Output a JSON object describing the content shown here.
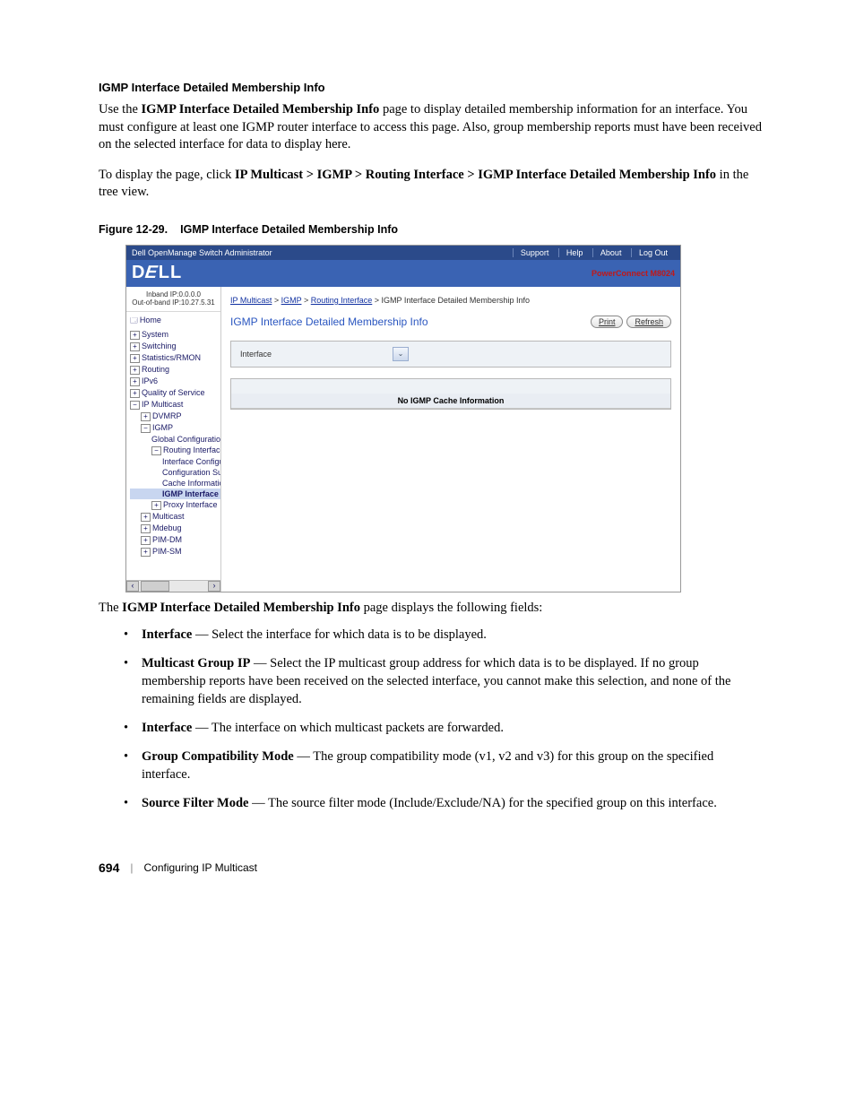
{
  "heading": "IGMP Interface Detailed Membership Info",
  "para1_a": "Use the ",
  "para1_bold": "IGMP Interface Detailed Membership Info",
  "para1_b": " page to display detailed membership information for an interface. You must configure at least one IGMP router interface to access this page. Also, group membership reports must have been received on the selected interface for data to display here.",
  "para2_a": "To display the page, click ",
  "para2_bold": "IP Multicast > IGMP > Routing Interface > IGMP Interface Detailed Membership Info",
  "para2_b": " in the tree view.",
  "fig_num": "Figure 12-29.",
  "fig_title": "IGMP Interface Detailed Membership Info",
  "screenshot": {
    "topbar_left": "Dell OpenManage Switch Administrator",
    "topbar_links": [
      "Support",
      "Help",
      "About",
      "Log Out"
    ],
    "brand": "DELL",
    "model": "PowerConnect M8024",
    "nav_ip1": "Inband IP:0.0.0.0",
    "nav_ip2": "Out-of-band IP:10.27.5.31",
    "nav": {
      "home": "Home",
      "system": "System",
      "switching": "Switching",
      "stats": "Statistics/RMON",
      "routing": "Routing",
      "ipv6": "IPv6",
      "qos": "Quality of Service",
      "ipmc": "IP Multicast",
      "dvmrp": "DVMRP",
      "igmp": "IGMP",
      "global": "Global Configuration",
      "rif": "Routing Interface",
      "ifconf": "Interface Configura",
      "confsum": "Configuration Sum",
      "cache": "Cache Information",
      "selected": "IGMP Interface D",
      "proxy": "Proxy Interface",
      "multicast": "Multicast",
      "mdebug": "Mdebug",
      "pimdm": "PIM-DM",
      "pimsm": "PIM-SM"
    },
    "breadcrumb": {
      "a": "IP Multicast",
      "b": "IGMP",
      "c": "Routing Interface",
      "d": "IGMP Interface Detailed Membership Info"
    },
    "main_title": "IGMP Interface Detailed Membership Info",
    "btn_print": "Print",
    "btn_refresh": "Refresh",
    "field_label": "Interface",
    "panel2_hdr": "No IGMP Cache Information"
  },
  "after_a": "The ",
  "after_bold": "IGMP Interface Detailed Membership Info",
  "after_b": " page displays the following fields:",
  "bullets": [
    {
      "term": "Interface",
      "desc": " — Select the interface for which data is to be displayed."
    },
    {
      "term": "Multicast Group IP",
      "desc": " — Select the IP multicast group address for which data is to be displayed. If no group membership reports have been received on the selected interface, you cannot make this selection, and none of the remaining fields are displayed."
    },
    {
      "term": "Interface",
      "desc": " — The interface on which multicast packets are forwarded."
    },
    {
      "term": "Group Compatibility Mode",
      "desc": " — The group compatibility mode (v1, v2 and v3) for this group on the specified interface."
    },
    {
      "term": "Source Filter Mode",
      "desc": " — The source filter mode (Include/Exclude/NA) for the specified group on this interface."
    }
  ],
  "footer_page": "694",
  "footer_chapter": "Configuring IP Multicast"
}
